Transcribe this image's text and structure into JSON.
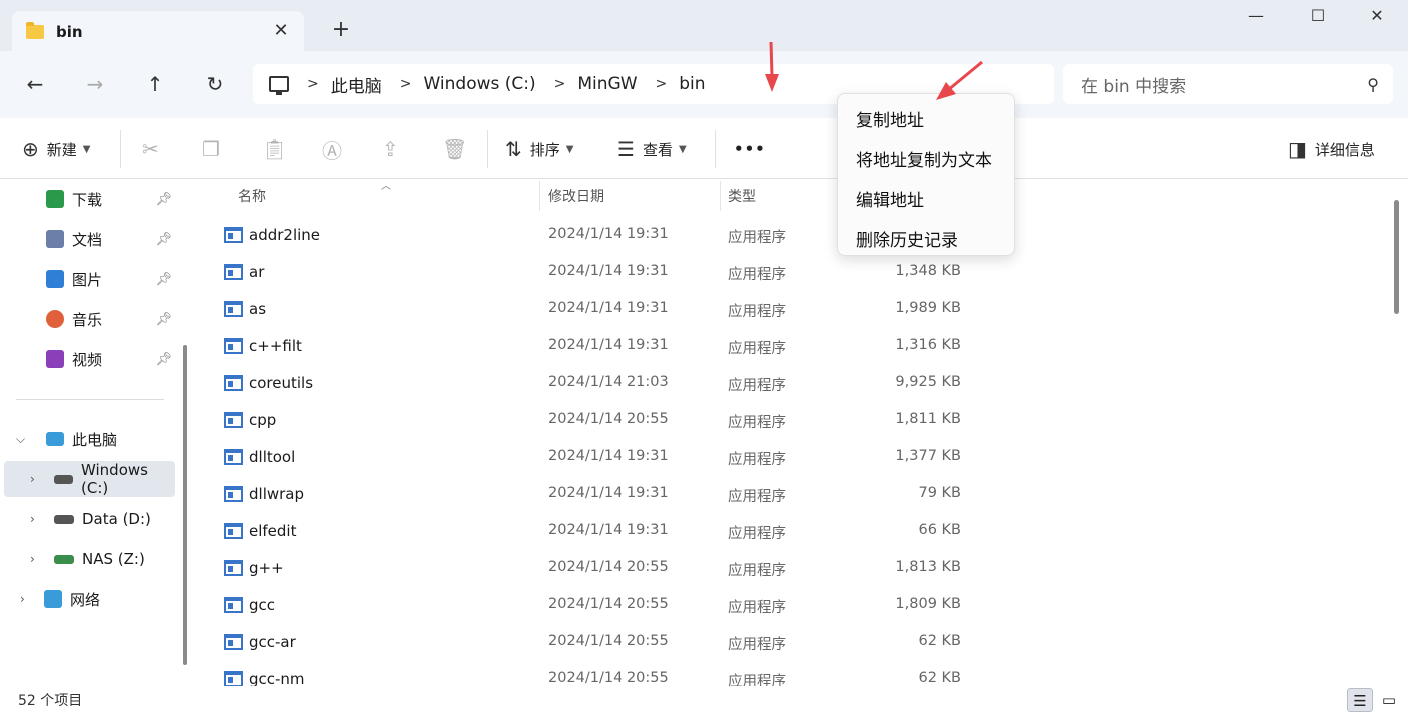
{
  "window": {
    "tab_title": "bin",
    "tab_close": "✕",
    "new_tab": "+",
    "minimize": "—",
    "maximize": "☐",
    "close": "✕"
  },
  "nav": {
    "back": "←",
    "forward": "→",
    "up": "↑",
    "refresh": "↻"
  },
  "breadcrumbs": [
    "此电脑",
    "Windows (C:)",
    "MinGW",
    "bin"
  ],
  "search": {
    "placeholder": "在 bin 中搜索"
  },
  "toolbar": {
    "new_label": "新建",
    "sort_label": "排序",
    "view_label": "查看",
    "more_label": "•••",
    "details_label": "详细信息"
  },
  "sidebar": {
    "quick_access": [
      {
        "label": "下载",
        "icon": "download-icon",
        "color": "#2a9a4a"
      },
      {
        "label": "文档",
        "icon": "document-icon",
        "color": "#6b7fa8"
      },
      {
        "label": "图片",
        "icon": "pictures-icon",
        "color": "#2f7fd6"
      },
      {
        "label": "音乐",
        "icon": "music-icon",
        "color": "#e0603c"
      },
      {
        "label": "视频",
        "icon": "video-icon",
        "color": "#8b3fb8"
      }
    ],
    "this_pc": "此电脑",
    "drives": [
      {
        "label": "Windows (C:)",
        "selected": true
      },
      {
        "label": "Data (D:)",
        "selected": false
      },
      {
        "label": "NAS (Z:)",
        "selected": false
      }
    ],
    "network": "网络"
  },
  "columns": {
    "name": "名称",
    "date": "修改日期",
    "type": "类型"
  },
  "files": [
    {
      "name": "addr2line",
      "date": "2024/1/14 19:31",
      "type": "应用程序",
      "size": ""
    },
    {
      "name": "ar",
      "date": "2024/1/14 19:31",
      "type": "应用程序",
      "size": "1,348 KB"
    },
    {
      "name": "as",
      "date": "2024/1/14 19:31",
      "type": "应用程序",
      "size": "1,989 KB"
    },
    {
      "name": "c++filt",
      "date": "2024/1/14 19:31",
      "type": "应用程序",
      "size": "1,316 KB"
    },
    {
      "name": "coreutils",
      "date": "2024/1/14 21:03",
      "type": "应用程序",
      "size": "9,925 KB"
    },
    {
      "name": "cpp",
      "date": "2024/1/14 20:55",
      "type": "应用程序",
      "size": "1,811 KB"
    },
    {
      "name": "dlltool",
      "date": "2024/1/14 19:31",
      "type": "应用程序",
      "size": "1,377 KB"
    },
    {
      "name": "dllwrap",
      "date": "2024/1/14 19:31",
      "type": "应用程序",
      "size": "79 KB"
    },
    {
      "name": "elfedit",
      "date": "2024/1/14 19:31",
      "type": "应用程序",
      "size": "66 KB"
    },
    {
      "name": "g++",
      "date": "2024/1/14 20:55",
      "type": "应用程序",
      "size": "1,813 KB"
    },
    {
      "name": "gcc",
      "date": "2024/1/14 20:55",
      "type": "应用程序",
      "size": "1,809 KB"
    },
    {
      "name": "gcc-ar",
      "date": "2024/1/14 20:55",
      "type": "应用程序",
      "size": "62 KB"
    },
    {
      "name": "gcc-nm",
      "date": "2024/1/14 20:55",
      "type": "应用程序",
      "size": "62 KB"
    }
  ],
  "status": {
    "item_count": "52 个项目"
  },
  "context_menu": [
    "复制地址",
    "将地址复制为文本",
    "编辑地址",
    "删除历史记录"
  ],
  "colors": {
    "accent": "#3875c8",
    "annotation": "#e8474b"
  }
}
